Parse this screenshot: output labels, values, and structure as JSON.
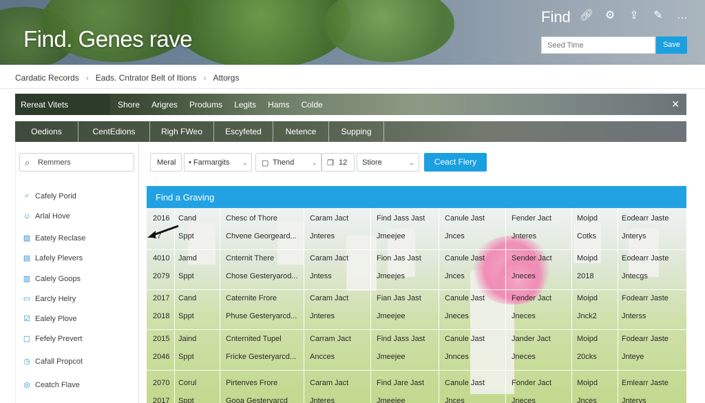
{
  "header": {
    "title": "Find. Genes rave",
    "find_label": "Find",
    "icons": [
      "link-icon",
      "gear-icon",
      "share-icon",
      "edit-icon",
      "more-icon"
    ],
    "search_placeholder": "Seed Time",
    "save_label": "Save"
  },
  "breadcrumb": [
    "Cardatic Records",
    "Eads. Cntrator Belt of Itions",
    "Attorgs"
  ],
  "bar1": {
    "section": "Rereat Vitets",
    "items": [
      "Shore",
      "Arigres",
      "Produms",
      "Legits",
      "Hams",
      "Colde"
    ],
    "close": "✕"
  },
  "tabs": [
    "Oedions",
    "CentEdions",
    "Righ FWeo",
    "Escyfeted",
    "Netence",
    "Supping"
  ],
  "sidebar": {
    "search_value": "Remmers",
    "items": [
      {
        "label": "Cafely Porid",
        "icon": "search-icon"
      },
      {
        "label": "Arlal Hove",
        "icon": "user-icon"
      },
      {
        "label": "Eately Reclase",
        "icon": "tag-icon"
      },
      {
        "label": "Lafely Plevers",
        "icon": "bookmark-icon"
      },
      {
        "label": "Calely Goops",
        "icon": "document-icon"
      },
      {
        "label": "Earcly Helry",
        "icon": "card-icon"
      },
      {
        "label": "Ealely Plove",
        "icon": "check-icon"
      },
      {
        "label": "Fefely Prevert",
        "icon": "chat-icon"
      },
      {
        "label": "Cafall Propcot",
        "icon": "clock-icon"
      },
      {
        "label": "Ceatch Flave",
        "icon": "target-icon"
      }
    ]
  },
  "filters": {
    "f1": "Meral",
    "f2": "• Farmargits",
    "f3": "Thend",
    "f4": "12",
    "f5": "Stiore",
    "find_button": "Ceact Flery"
  },
  "table": {
    "title": "Find a Graving",
    "rows": [
      {
        "c": [
          [
            "2016",
            "17"
          ],
          [
            "Cand",
            "Sppt"
          ],
          [
            "Chesc of Thore",
            "Chvene Georgeard..."
          ],
          [
            "Caram Jact",
            "Jnteres"
          ],
          [
            "Find Jass Jast",
            "Jmeejee"
          ],
          [
            "Canule Jast",
            "Jnces"
          ],
          [
            "Fender Jact",
            "Jnteres"
          ],
          [
            "Moipd",
            "Cotks"
          ],
          [
            "Eodearr Jaste",
            "Jnterys"
          ]
        ]
      },
      {
        "c": [
          [
            "4010",
            "2079"
          ],
          [
            "Jamd",
            "Sppt"
          ],
          [
            "Cnternit There",
            "Chose Gesteryarod..."
          ],
          [
            "Caram Jact",
            "Jntess"
          ],
          [
            "Fion Jas Jast",
            "Jmeejes"
          ],
          [
            "Canule Jast",
            "Jnces"
          ],
          [
            "Sender Jact",
            "Jneces"
          ],
          [
            "Moipd",
            "2018"
          ],
          [
            "Eodearr Jaste",
            "Jntecgs"
          ]
        ]
      },
      {
        "c": [
          [
            "2017",
            "2018"
          ],
          [
            "Cand",
            "Sppt"
          ],
          [
            "Caternite Frore",
            "Phuse Gesteryarcd..."
          ],
          [
            "Caram Jact",
            "Jnteres"
          ],
          [
            "Fian Jas Jast",
            "Jmeejee"
          ],
          [
            "Canule Jast",
            "Jneces"
          ],
          [
            "Fender Jact",
            "Jneces"
          ],
          [
            "Moipd",
            "Jnck2"
          ],
          [
            "Fodearr Jaste",
            "Jnterss"
          ]
        ]
      },
      {
        "c": [
          [
            "2015",
            "2046"
          ],
          [
            "Jaind",
            "Sppt"
          ],
          [
            "Cnternited Tupel",
            "Fricke Gesteryarcd..."
          ],
          [
            "Carram Jact",
            "Ancces"
          ],
          [
            "Find Jass Jast",
            "Jmeejee"
          ],
          [
            "Canule Jast",
            "Jnnces"
          ],
          [
            "Jander Jact",
            "Jneces"
          ],
          [
            "Moipd",
            "20cks"
          ],
          [
            "Fodearr Jaste",
            "Jnteye"
          ]
        ]
      },
      {
        "c": [
          [
            "2070",
            "2017"
          ],
          [
            "Corul",
            "Sppt"
          ],
          [
            "Pirtenves Frore",
            "Gooa Gesteryarcd"
          ],
          [
            "Caram Jact",
            "Jnteres"
          ],
          [
            "Find Jare Jast",
            "Jmeejee"
          ],
          [
            "Canule Jast",
            "Jnces"
          ],
          [
            "Fonder Jact",
            "Jneces"
          ],
          [
            "Moipd",
            "Jnces"
          ],
          [
            "Emlearr Jaste",
            "Jnterys"
          ]
        ]
      }
    ]
  },
  "colors": {
    "accent": "#1a9fe0",
    "table_header": "#22a2e2",
    "dark_bar": "#2d3b2a"
  }
}
